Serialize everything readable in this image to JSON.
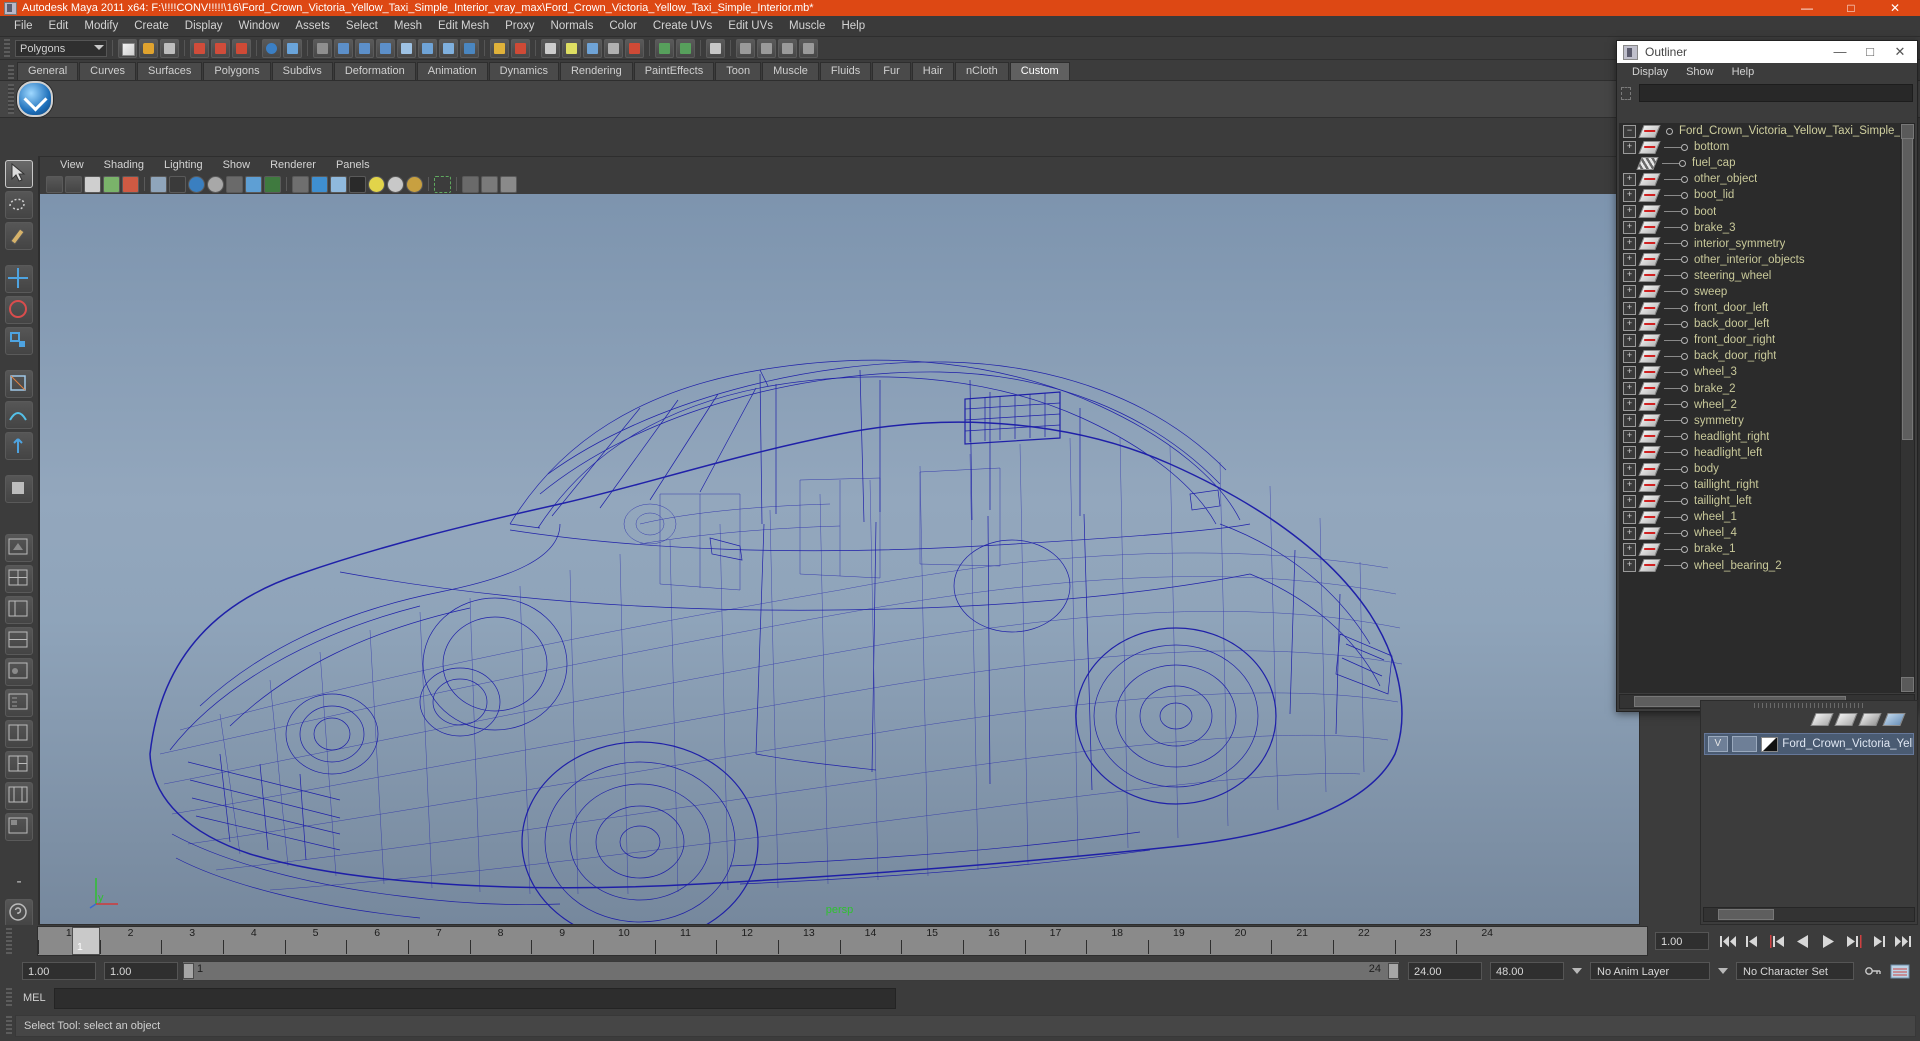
{
  "window": {
    "title": "Autodesk Maya 2011 x64: F:\\!!!!CONV!!!!!\\16\\Ford_Crown_Victoria_Yellow_Taxi_Simple_Interior_vray_max\\Ford_Crown_Victoria_Yellow_Taxi_Simple_Interior.mb*",
    "minimize": "—",
    "maximize": "□",
    "close": "✕",
    "titlebar_color": "#dd4814"
  },
  "menubar": {
    "items": [
      "File",
      "Edit",
      "Modify",
      "Create",
      "Display",
      "Window",
      "Assets",
      "Select",
      "Mesh",
      "Edit Mesh",
      "Proxy",
      "Normals",
      "Color",
      "Create UVs",
      "Edit UVs",
      "Muscle",
      "Help"
    ]
  },
  "statusline": {
    "selection_mask": "Polygons"
  },
  "shelf": {
    "tabs": [
      "General",
      "Curves",
      "Surfaces",
      "Polygons",
      "Subdivs",
      "Deformation",
      "Animation",
      "Dynamics",
      "Rendering",
      "PaintEffects",
      "Toon",
      "Muscle",
      "Fluids",
      "Fur",
      "Hair",
      "nCloth",
      "Custom"
    ],
    "active_tab": "Custom"
  },
  "viewport": {
    "menus": [
      "View",
      "Shading",
      "Lighting",
      "Show",
      "Renderer",
      "Panels"
    ],
    "camera_label": "persp",
    "axis_label": "y",
    "wireframe_color": "#1a1aa8",
    "background_top": "#7d94ae",
    "background_bottom": "#76889d"
  },
  "outliner": {
    "title": "Outliner",
    "minimize": "—",
    "maximize": "□",
    "close": "✕",
    "menus": [
      "Display",
      "Show",
      "Help"
    ],
    "search_value": "",
    "items": [
      {
        "label": "Ford_Crown_Victoria_Yellow_Taxi_Simple_Int",
        "expander": "minus",
        "icon": "mesh-icon",
        "root": true
      },
      {
        "label": "bottom",
        "expander": "plus",
        "icon": "mesh-icon"
      },
      {
        "label": "fuel_cap",
        "expander": "none",
        "icon": "mesh-rough-icon"
      },
      {
        "label": "other_object",
        "expander": "plus",
        "icon": "mesh-icon"
      },
      {
        "label": "boot_lid",
        "expander": "plus",
        "icon": "mesh-icon"
      },
      {
        "label": "boot",
        "expander": "plus",
        "icon": "mesh-icon"
      },
      {
        "label": "brake_3",
        "expander": "plus",
        "icon": "mesh-icon"
      },
      {
        "label": "interior_symmetry",
        "expander": "plus",
        "icon": "mesh-icon"
      },
      {
        "label": "other_interior_objects",
        "expander": "plus",
        "icon": "mesh-icon"
      },
      {
        "label": "steering_wheel",
        "expander": "plus",
        "icon": "mesh-icon"
      },
      {
        "label": "sweep",
        "expander": "plus",
        "icon": "mesh-icon"
      },
      {
        "label": "front_door_left",
        "expander": "plus",
        "icon": "mesh-icon"
      },
      {
        "label": "back_door_left",
        "expander": "plus",
        "icon": "mesh-icon"
      },
      {
        "label": "front_door_right",
        "expander": "plus",
        "icon": "mesh-icon"
      },
      {
        "label": "back_door_right",
        "expander": "plus",
        "icon": "mesh-icon"
      },
      {
        "label": "wheel_3",
        "expander": "plus",
        "icon": "mesh-icon"
      },
      {
        "label": "brake_2",
        "expander": "plus",
        "icon": "mesh-icon"
      },
      {
        "label": "wheel_2",
        "expander": "plus",
        "icon": "mesh-icon"
      },
      {
        "label": "symmetry",
        "expander": "plus",
        "icon": "mesh-icon"
      },
      {
        "label": "headlight_right",
        "expander": "plus",
        "icon": "mesh-icon"
      },
      {
        "label": "headlight_left",
        "expander": "plus",
        "icon": "mesh-icon"
      },
      {
        "label": "body",
        "expander": "plus",
        "icon": "mesh-icon"
      },
      {
        "label": "taillight_right",
        "expander": "plus",
        "icon": "mesh-icon"
      },
      {
        "label": "taillight_left",
        "expander": "plus",
        "icon": "mesh-icon"
      },
      {
        "label": "wheel_1",
        "expander": "plus",
        "icon": "mesh-icon"
      },
      {
        "label": "wheel_4",
        "expander": "plus",
        "icon": "mesh-icon"
      },
      {
        "label": "brake_1",
        "expander": "plus",
        "icon": "mesh-icon"
      },
      {
        "label": "wheel_bearing_2",
        "expander": "plus",
        "icon": "mesh-icon"
      }
    ]
  },
  "right_panel": {
    "selected_label": "Ford_Crown_Victoria_Yell",
    "visibility_toggle": "V"
  },
  "timeslider": {
    "current_frame": "1",
    "ticks": [
      "1",
      "2",
      "3",
      "4",
      "5",
      "6",
      "7",
      "8",
      "9",
      "10",
      "11",
      "12",
      "13",
      "14",
      "15",
      "16",
      "17",
      "18",
      "19",
      "20",
      "21",
      "22",
      "23",
      "24"
    ],
    "playback_speed": "1.00"
  },
  "range": {
    "anim_start": "1.00",
    "anim_end": "1.00",
    "range_start_label": "1",
    "range_end_label": "24",
    "playback_end": "24.00",
    "anim_end_total": "48.00",
    "anim_layer": "No Anim Layer",
    "character_set": "No Character Set"
  },
  "command_line": {
    "language": "MEL",
    "value": ""
  },
  "status_bar": {
    "message": "Select Tool: select an object"
  }
}
